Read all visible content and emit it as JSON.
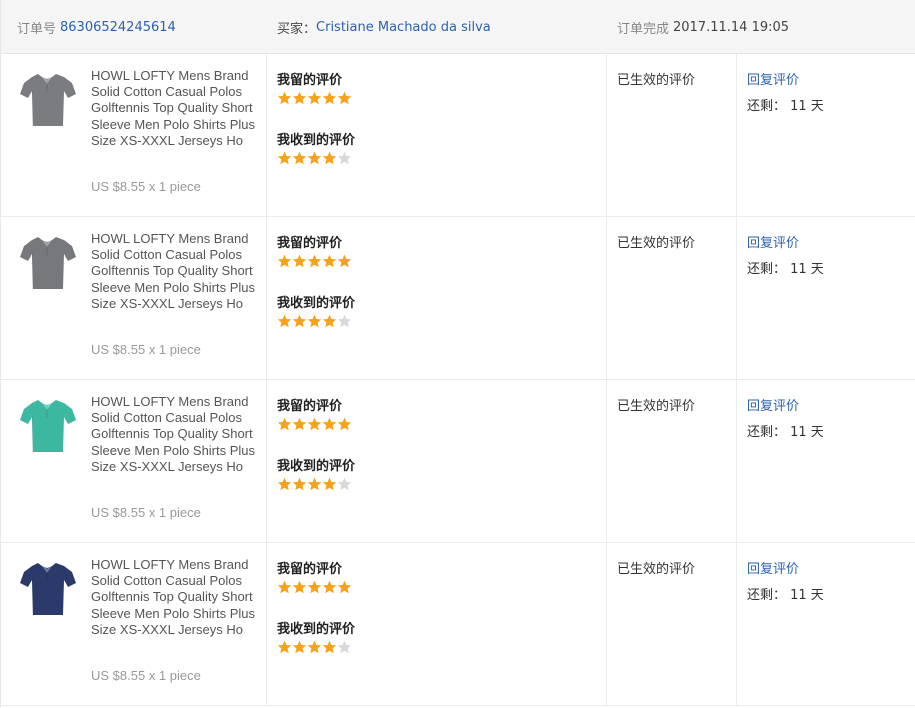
{
  "header": {
    "order_label": "订单号",
    "order_number": "86306524245614",
    "buyer_label": "买家：",
    "buyer_name": "Cristiane Machado da silva",
    "time_label": "订单完成",
    "time_value": "2017.11.14 19:05"
  },
  "colors": {
    "star_on": "#f7a21b",
    "star_off": "#d9d9d9",
    "link": "#2b62b0",
    "shirt_colors": [
      "#7b7c80",
      "#77787c",
      "#3cb8a0",
      "#2b3a6b"
    ]
  },
  "rows": [
    {
      "product_title": "HOWL LOFTY Mens Brand Solid Cotton Casual Polos Golftennis Top Quality Short Sleeve Men Polo Shirts Plus Size XS-XXXL Jerseys Ho",
      "product_price": "US $8.55 x 1 piece",
      "my_review_label": "我留的评价",
      "my_stars": 5,
      "received_review_label": "我收到的评价",
      "received_stars": 4,
      "status": "已生效的评价",
      "reply_label": "回复评价",
      "remaining": "还剩： 11 天"
    },
    {
      "product_title": "HOWL LOFTY Mens Brand Solid Cotton Casual Polos Golftennis Top Quality Short Sleeve Men Polo Shirts Plus Size XS-XXXL Jerseys Ho",
      "product_price": "US $8.55 x 1 piece",
      "my_review_label": "我留的评价",
      "my_stars": 5,
      "received_review_label": "我收到的评价",
      "received_stars": 4,
      "status": "已生效的评价",
      "reply_label": "回复评价",
      "remaining": "还剩： 11 天"
    },
    {
      "product_title": "HOWL LOFTY Mens Brand Solid Cotton Casual Polos Golftennis Top Quality Short Sleeve Men Polo Shirts Plus Size XS-XXXL Jerseys Ho",
      "product_price": "US $8.55 x 1 piece",
      "my_review_label": "我留的评价",
      "my_stars": 5,
      "received_review_label": "我收到的评价",
      "received_stars": 4,
      "status": "已生效的评价",
      "reply_label": "回复评价",
      "remaining": "还剩： 11 天"
    },
    {
      "product_title": "HOWL LOFTY Mens Brand Solid Cotton Casual Polos Golftennis Top Quality Short Sleeve Men Polo Shirts Plus Size XS-XXXL Jerseys Ho",
      "product_price": "US $8.55 x 1 piece",
      "my_review_label": "我留的评价",
      "my_stars": 5,
      "received_review_label": "我收到的评价",
      "received_stars": 4,
      "status": "已生效的评价",
      "reply_label": "回复评价",
      "remaining": "还剩： 11 天"
    }
  ]
}
